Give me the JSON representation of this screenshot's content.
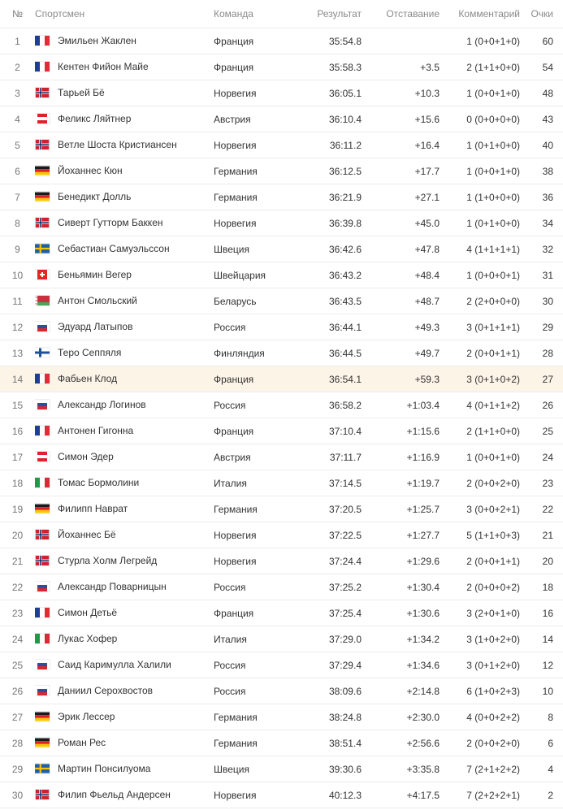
{
  "headers": {
    "num": "№",
    "athlete": "Спортсмен",
    "team": "Команда",
    "result": "Результат",
    "gap": "Отставание",
    "comment": "Комментарий",
    "points": "Очки"
  },
  "rows": [
    {
      "num": "1",
      "flag": "france-flag-icon",
      "name": "Эмильен Жаклен",
      "team": "Франция",
      "result": "35:54.8",
      "gap": "",
      "comment": "1 (0+0+1+0)",
      "points": "60"
    },
    {
      "num": "2",
      "flag": "france-flag-icon",
      "name": "Кентен Фийон Майе",
      "team": "Франция",
      "result": "35:58.3",
      "gap": "+3.5",
      "comment": "2 (1+1+0+0)",
      "points": "54"
    },
    {
      "num": "3",
      "flag": "norway-flag-icon",
      "name": "Тарьей Бё",
      "team": "Норвегия",
      "result": "36:05.1",
      "gap": "+10.3",
      "comment": "1 (0+0+1+0)",
      "points": "48"
    },
    {
      "num": "4",
      "flag": "austria-flag-icon",
      "name": "Феликс Ляйтнер",
      "team": "Австрия",
      "result": "36:10.4",
      "gap": "+15.6",
      "comment": "0 (0+0+0+0)",
      "points": "43"
    },
    {
      "num": "5",
      "flag": "norway-flag-icon",
      "name": "Ветле Шоста Кристиансен",
      "team": "Норвегия",
      "result": "36:11.2",
      "gap": "+16.4",
      "comment": "1 (0+1+0+0)",
      "points": "40"
    },
    {
      "num": "6",
      "flag": "germany-flag-icon",
      "name": "Йоханнес Кюн",
      "team": "Германия",
      "result": "36:12.5",
      "gap": "+17.7",
      "comment": "1 (0+0+1+0)",
      "points": "38"
    },
    {
      "num": "7",
      "flag": "germany-flag-icon",
      "name": "Бенедикт Долль",
      "team": "Германия",
      "result": "36:21.9",
      "gap": "+27.1",
      "comment": "1 (1+0+0+0)",
      "points": "36"
    },
    {
      "num": "8",
      "flag": "norway-flag-icon",
      "name": "Сиверт Гутторм Баккен",
      "team": "Норвегия",
      "result": "36:39.8",
      "gap": "+45.0",
      "comment": "1 (0+1+0+0)",
      "points": "34"
    },
    {
      "num": "9",
      "flag": "sweden-flag-icon",
      "name": "Себастиан Самуэльссон",
      "team": "Швеция",
      "result": "36:42.6",
      "gap": "+47.8",
      "comment": "4 (1+1+1+1)",
      "points": "32"
    },
    {
      "num": "10",
      "flag": "switzerland-flag-icon",
      "name": "Беньямин Вегер",
      "team": "Швейцария",
      "result": "36:43.2",
      "gap": "+48.4",
      "comment": "1 (0+0+0+1)",
      "points": "31"
    },
    {
      "num": "11",
      "flag": "belarus-flag-icon",
      "name": "Антон Смольский",
      "team": "Беларусь",
      "result": "36:43.5",
      "gap": "+48.7",
      "comment": "2 (2+0+0+0)",
      "points": "30"
    },
    {
      "num": "12",
      "flag": "russia-flag-icon",
      "name": "Эдуард Латыпов",
      "team": "Россия",
      "result": "36:44.1",
      "gap": "+49.3",
      "comment": "3 (0+1+1+1)",
      "points": "29"
    },
    {
      "num": "13",
      "flag": "finland-flag-icon",
      "name": "Теро Сеппяля",
      "team": "Финляндия",
      "result": "36:44.5",
      "gap": "+49.7",
      "comment": "2 (0+0+1+1)",
      "points": "28"
    },
    {
      "num": "14",
      "flag": "france-flag-icon",
      "name": "Фабьен Клод",
      "team": "Франция",
      "result": "36:54.1",
      "gap": "+59.3",
      "comment": "3 (0+1+0+2)",
      "points": "27",
      "highlight": true
    },
    {
      "num": "15",
      "flag": "russia-flag-icon",
      "name": "Александр Логинов",
      "team": "Россия",
      "result": "36:58.2",
      "gap": "+1:03.4",
      "comment": "4 (0+1+1+2)",
      "points": "26"
    },
    {
      "num": "16",
      "flag": "france-flag-icon",
      "name": "Антонен Гигонна",
      "team": "Франция",
      "result": "37:10.4",
      "gap": "+1:15.6",
      "comment": "2 (1+1+0+0)",
      "points": "25"
    },
    {
      "num": "17",
      "flag": "austria-flag-icon",
      "name": "Симон Эдер",
      "team": "Австрия",
      "result": "37:11.7",
      "gap": "+1:16.9",
      "comment": "1 (0+0+1+0)",
      "points": "24"
    },
    {
      "num": "18",
      "flag": "italy-flag-icon",
      "name": "Томас Бормолини",
      "team": "Италия",
      "result": "37:14.5",
      "gap": "+1:19.7",
      "comment": "2 (0+0+2+0)",
      "points": "23"
    },
    {
      "num": "19",
      "flag": "germany-flag-icon",
      "name": "Филипп Наврат",
      "team": "Германия",
      "result": "37:20.5",
      "gap": "+1:25.7",
      "comment": "3 (0+0+2+1)",
      "points": "22"
    },
    {
      "num": "20",
      "flag": "norway-flag-icon",
      "name": "Йоханнес Бё",
      "team": "Норвегия",
      "result": "37:22.5",
      "gap": "+1:27.7",
      "comment": "5 (1+1+0+3)",
      "points": "21"
    },
    {
      "num": "21",
      "flag": "norway-flag-icon",
      "name": "Стурла Холм Легрейд",
      "team": "Норвегия",
      "result": "37:24.4",
      "gap": "+1:29.6",
      "comment": "2 (0+0+1+1)",
      "points": "20"
    },
    {
      "num": "22",
      "flag": "russia-flag-icon",
      "name": "Александр Поварницын",
      "team": "Россия",
      "result": "37:25.2",
      "gap": "+1:30.4",
      "comment": "2 (0+0+0+2)",
      "points": "18"
    },
    {
      "num": "23",
      "flag": "france-flag-icon",
      "name": "Симон Детьё",
      "team": "Франция",
      "result": "37:25.4",
      "gap": "+1:30.6",
      "comment": "3 (2+0+1+0)",
      "points": "16"
    },
    {
      "num": "24",
      "flag": "italy-flag-icon",
      "name": "Лукас Хофер",
      "team": "Италия",
      "result": "37:29.0",
      "gap": "+1:34.2",
      "comment": "3 (1+0+2+0)",
      "points": "14"
    },
    {
      "num": "25",
      "flag": "russia-flag-icon",
      "name": "Саид Каримулла Халили",
      "team": "Россия",
      "result": "37:29.4",
      "gap": "+1:34.6",
      "comment": "3 (0+1+2+0)",
      "points": "12"
    },
    {
      "num": "26",
      "flag": "russia-flag-icon",
      "name": "Даниил Серохвостов",
      "team": "Россия",
      "result": "38:09.6",
      "gap": "+2:14.8",
      "comment": "6 (1+0+2+3)",
      "points": "10"
    },
    {
      "num": "27",
      "flag": "germany-flag-icon",
      "name": "Эрик Лессер",
      "team": "Германия",
      "result": "38:24.8",
      "gap": "+2:30.0",
      "comment": "4 (0+0+2+2)",
      "points": "8"
    },
    {
      "num": "28",
      "flag": "germany-flag-icon",
      "name": "Роман Рес",
      "team": "Германия",
      "result": "38:51.4",
      "gap": "+2:56.6",
      "comment": "2 (0+0+2+0)",
      "points": "6"
    },
    {
      "num": "29",
      "flag": "sweden-flag-icon",
      "name": "Мартин Понсилуома",
      "team": "Швеция",
      "result": "39:30.6",
      "gap": "+3:35.8",
      "comment": "7 (2+1+2+2)",
      "points": "4"
    },
    {
      "num": "30",
      "flag": "norway-flag-icon",
      "name": "Филип Фьельд Андерсен",
      "team": "Норвегия",
      "result": "40:12.3",
      "gap": "+4:17.5",
      "comment": "7 (2+2+2+1)",
      "points": "2"
    }
  ]
}
